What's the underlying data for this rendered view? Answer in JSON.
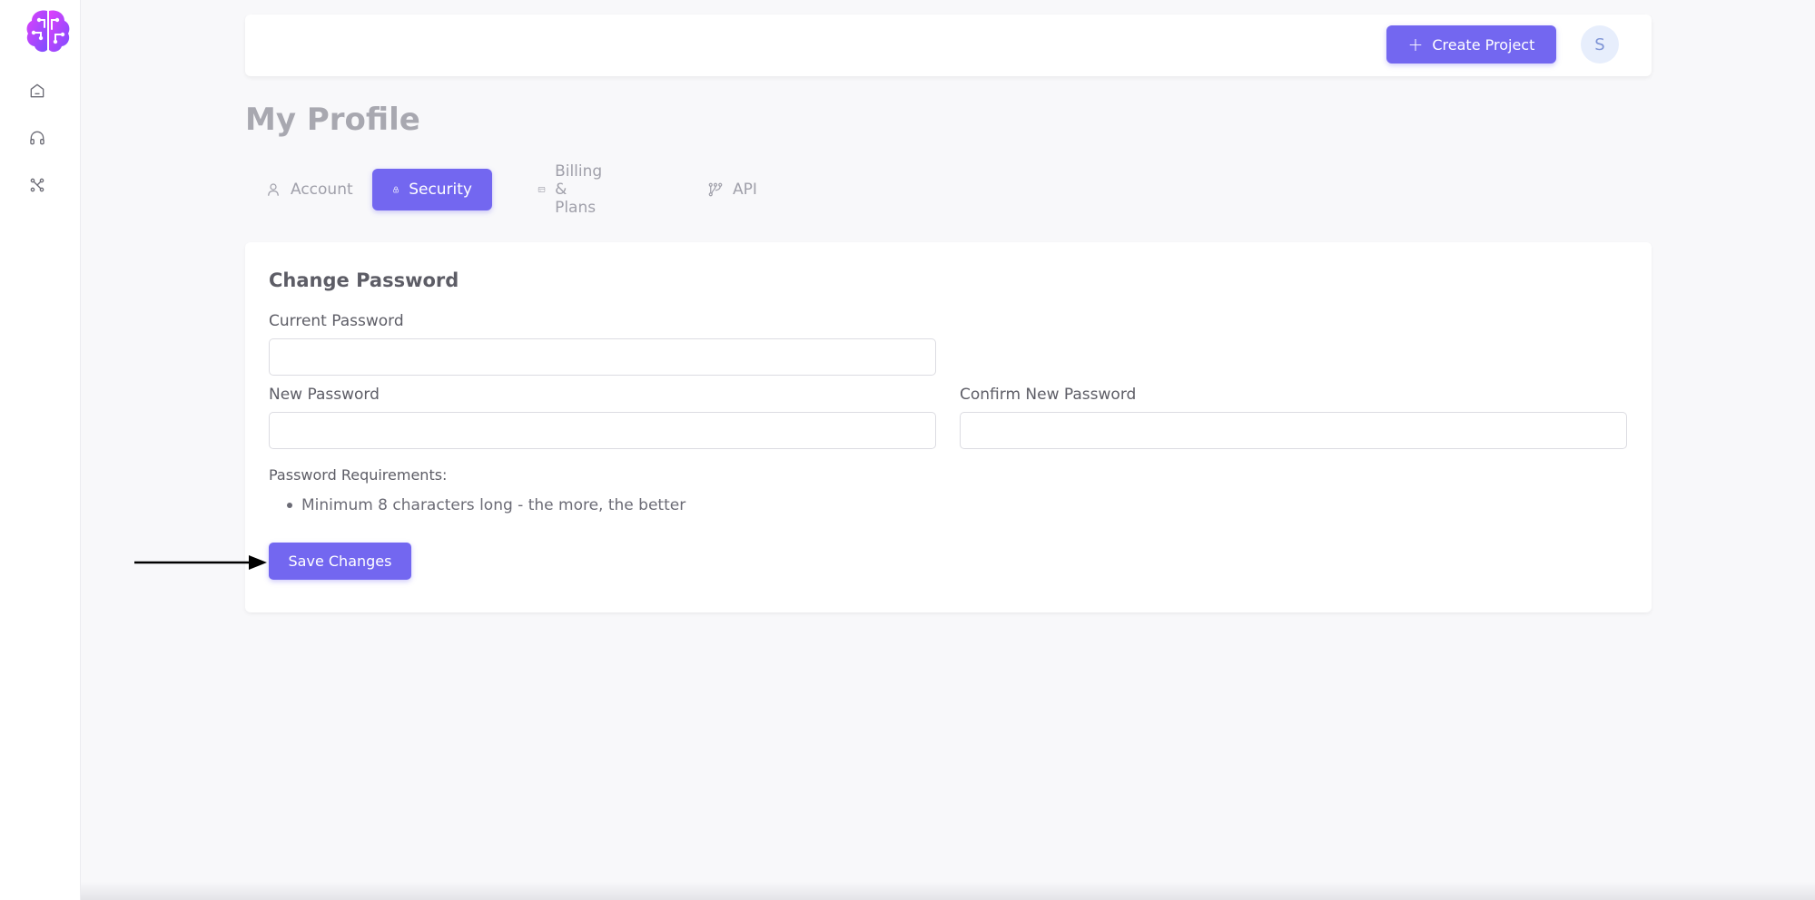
{
  "sidebar": {
    "logo_icon": "brain-circuit-logo",
    "items": [
      {
        "icon": "home-icon"
      },
      {
        "icon": "headphones-icon"
      },
      {
        "icon": "network-icon"
      }
    ]
  },
  "header": {
    "create_project_label": "Create Project",
    "avatar_initial": "S"
  },
  "page": {
    "title": "My Profile"
  },
  "tabs": [
    {
      "label": "Account",
      "icon": "user-icon",
      "active": false
    },
    {
      "label": "Security",
      "icon": "lock-icon",
      "active": true
    },
    {
      "label": "Billing & Plans",
      "icon": "card-icon",
      "active": false
    },
    {
      "label": "API",
      "icon": "api-icon",
      "active": false
    }
  ],
  "change_password": {
    "title": "Change Password",
    "current_password_label": "Current Password",
    "current_password_value": "",
    "new_password_label": "New Password",
    "new_password_value": "",
    "confirm_password_label": "Confirm New Password",
    "confirm_password_value": "",
    "requirements_title": "Password Requirements:",
    "requirements": [
      "Minimum 8 characters long - the more, the better"
    ],
    "save_label": "Save Changes"
  },
  "colors": {
    "primary": "#7367f0",
    "background": "#f8f8fa",
    "title_muted": "#a8a8b0"
  }
}
